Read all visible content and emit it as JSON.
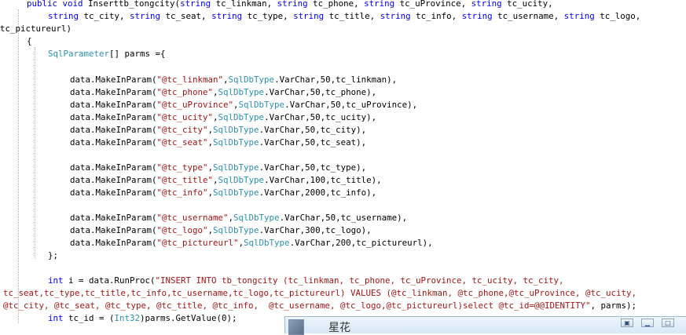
{
  "code": {
    "lines": [
      [
        [
          "kw",
          "public"
        ],
        [
          "p",
          " "
        ],
        [
          "kw",
          "void"
        ],
        [
          "p",
          " Inserttb_tongcity("
        ],
        [
          "kw",
          "string"
        ],
        [
          "p",
          " tc_linkman, "
        ],
        [
          "kw",
          "string"
        ],
        [
          "p",
          " tc_phone, "
        ],
        [
          "kw",
          "string"
        ],
        [
          "p",
          " tc_uProvince, "
        ],
        [
          "kw",
          "string"
        ],
        [
          "p",
          " tc_ucity,"
        ]
      ],
      [
        [
          "kw",
          "string"
        ],
        [
          "p",
          " tc_city, "
        ],
        [
          "kw",
          "string"
        ],
        [
          "p",
          " tc_seat, "
        ],
        [
          "kw",
          "string"
        ],
        [
          "p",
          " tc_type, "
        ],
        [
          "kw",
          "string"
        ],
        [
          "p",
          " tc_title, "
        ],
        [
          "kw",
          "string"
        ],
        [
          "p",
          " tc_info, "
        ],
        [
          "kw",
          "string"
        ],
        [
          "p",
          " tc_username, "
        ],
        [
          "kw",
          "string"
        ],
        [
          "p",
          " tc_logo,"
        ]
      ],
      [
        [
          "p",
          "tc_pictureurl)"
        ]
      ],
      [
        [
          "p",
          "{"
        ]
      ],
      [
        [
          "type",
          "SqlParameter"
        ],
        [
          "p",
          "[] parms ={"
        ]
      ],
      [
        [
          "p",
          "data.MakeInParam("
        ],
        [
          "str",
          "\"@tc_linkman\""
        ],
        [
          "p",
          ","
        ],
        [
          "type",
          "SqlDbType"
        ],
        [
          "p",
          ".VarChar,50,tc_linkman),"
        ]
      ],
      [
        [
          "p",
          "data.MakeInParam("
        ],
        [
          "str",
          "\"@tc_phone\""
        ],
        [
          "p",
          ","
        ],
        [
          "type",
          "SqlDbType"
        ],
        [
          "p",
          ".VarChar,50,tc_phone),"
        ]
      ],
      [
        [
          "p",
          "data.MakeInParam("
        ],
        [
          "str",
          "\"@tc_uProvince\""
        ],
        [
          "p",
          ","
        ],
        [
          "type",
          "SqlDbType"
        ],
        [
          "p",
          ".VarChar,50,tc_uProvince),"
        ]
      ],
      [
        [
          "p",
          "data.MakeInParam("
        ],
        [
          "str",
          "\"@tc_ucity\""
        ],
        [
          "p",
          ","
        ],
        [
          "type",
          "SqlDbType"
        ],
        [
          "p",
          ".VarChar,50,tc_ucity),"
        ]
      ],
      [
        [
          "p",
          "data.MakeInParam("
        ],
        [
          "str",
          "\"@tc_city\""
        ],
        [
          "p",
          ","
        ],
        [
          "type",
          "SqlDbType"
        ],
        [
          "p",
          ".VarChar,50,tc_city),"
        ]
      ],
      [
        [
          "p",
          "data.MakeInParam("
        ],
        [
          "str",
          "\"@tc_seat\""
        ],
        [
          "p",
          ","
        ],
        [
          "type",
          "SqlDbType"
        ],
        [
          "p",
          ".VarChar,50,tc_seat),"
        ]
      ],
      [
        [
          "p",
          "data.MakeInParam("
        ],
        [
          "str",
          "\"@tc_type\""
        ],
        [
          "p",
          ","
        ],
        [
          "type",
          "SqlDbType"
        ],
        [
          "p",
          ".VarChar,50,tc_type),"
        ]
      ],
      [
        [
          "p",
          "data.MakeInParam("
        ],
        [
          "str",
          "\"@tc_title\""
        ],
        [
          "p",
          ","
        ],
        [
          "type",
          "SqlDbType"
        ],
        [
          "p",
          ".VarChar,100,tc_title),"
        ]
      ],
      [
        [
          "p",
          "data.MakeInParam("
        ],
        [
          "str",
          "\"@tc_info\""
        ],
        [
          "p",
          ","
        ],
        [
          "type",
          "SqlDbType"
        ],
        [
          "p",
          ".VarChar,2000,tc_info),"
        ]
      ],
      [
        [
          "p",
          "data.MakeInParam("
        ],
        [
          "str",
          "\"@tc_username\""
        ],
        [
          "p",
          ","
        ],
        [
          "type",
          "SqlDbType"
        ],
        [
          "p",
          ".VarChar,50,tc_username),"
        ]
      ],
      [
        [
          "p",
          "data.MakeInParam("
        ],
        [
          "str",
          "\"@tc_logo\""
        ],
        [
          "p",
          ","
        ],
        [
          "type",
          "SqlDbType"
        ],
        [
          "p",
          ".VarChar,300,tc_logo),"
        ]
      ],
      [
        [
          "p",
          "data.MakeInParam("
        ],
        [
          "str",
          "\"@tc_pictureurl\""
        ],
        [
          "p",
          ","
        ],
        [
          "type",
          "SqlDbType"
        ],
        [
          "p",
          ".VarChar,200,tc_pictureurl),"
        ]
      ],
      [
        [
          "p",
          "};"
        ]
      ],
      [
        [
          "kw",
          "int"
        ],
        [
          "p",
          " i = data.RunProc("
        ],
        [
          "str",
          "\"INSERT INTO tb_tongcity (tc_linkman, tc_phone, tc_uProvince, tc_ucity, tc_city,"
        ]
      ],
      [
        [
          "str",
          "tc_seat,tc_type,tc_title,tc_info,tc_username,tc_logo,tc_pictureurl) VALUES (@tc_linkman, @tc_phone,@tc_uProvince, @tc_ucity,"
        ]
      ],
      [
        [
          "str",
          "@tc_city, @tc_seat, @tc_type, @tc_title, @tc_info,  @tc_username, @tc_logo,@tc_pictureurl)select @tc_id=@@IDENTITY\""
        ],
        [
          "p",
          ", parms);"
        ]
      ],
      [
        [
          "kw",
          "int"
        ],
        [
          "p",
          " tc_id = ("
        ],
        [
          "type",
          "Int32"
        ],
        [
          "p",
          ")parms.GetValue(0);"
        ]
      ]
    ]
  },
  "chat_window": {
    "title": "星花"
  }
}
